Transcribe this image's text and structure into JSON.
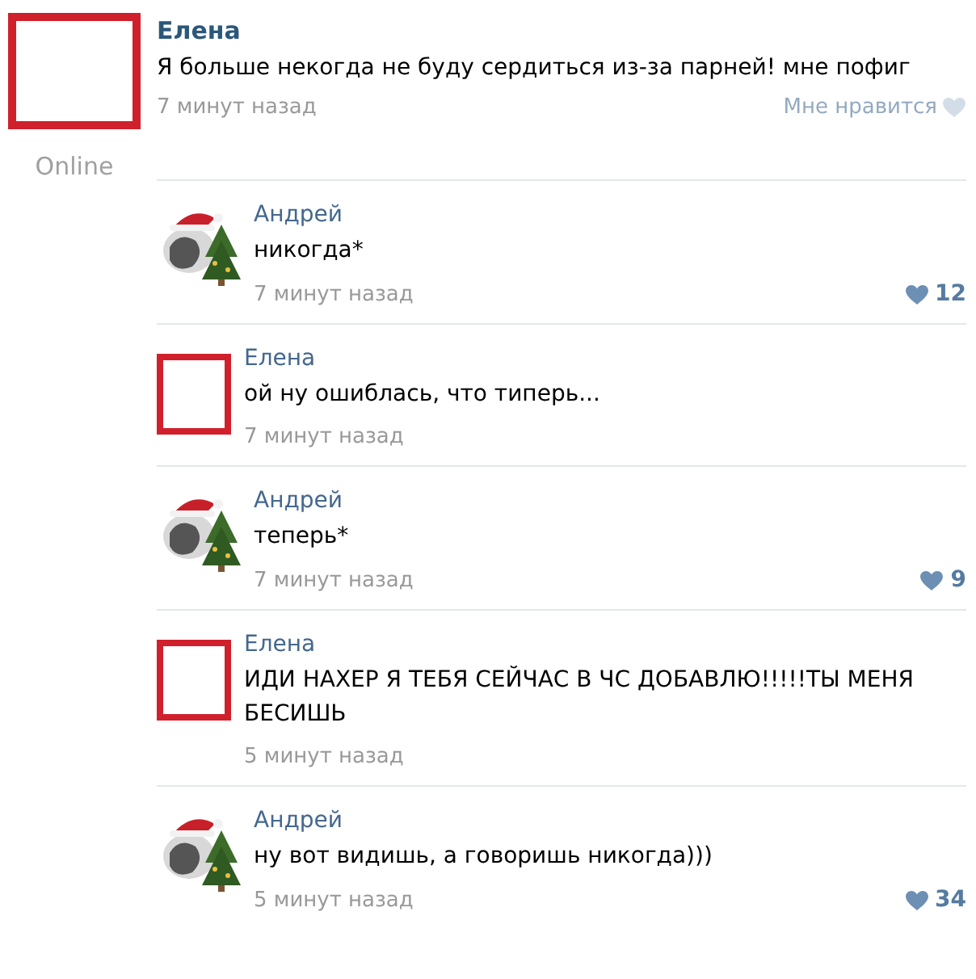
{
  "post": {
    "author": "Елена",
    "text": "Я больше некогда не буду сердиться из-за парней! мне пофиг",
    "status": "Online",
    "time": "7 минут назад",
    "like_label": "Мне нравится",
    "avatar": {
      "kind": "redacted"
    }
  },
  "replies": [
    {
      "author": "Андрей",
      "text": "никогда*",
      "time": "7 минут назад",
      "likes": "12"
    },
    {
      "author": "Елена",
      "text": "ой ну ошиблась, что типерь...",
      "time": "7 минут назад",
      "avatar": {
        "kind": "redacted"
      }
    },
    {
      "author": "Андрей",
      "text": "теперь*",
      "time": "7 минут назад",
      "likes": "9"
    },
    {
      "author": "Елена",
      "text": "ИДИ НАХЕР Я ТЕБЯ СЕЙЧАС В ЧС ДОБАВЛЮ!!!!!ТЫ МЕНЯ БЕСИШЬ",
      "time": "5 минут назад",
      "avatar": {
        "kind": "redacted"
      }
    },
    {
      "author": "Андрей",
      "text": "ну вот видишь, а говоришь никогда)))",
      "time": "5 минут назад",
      "likes": "34"
    }
  ]
}
